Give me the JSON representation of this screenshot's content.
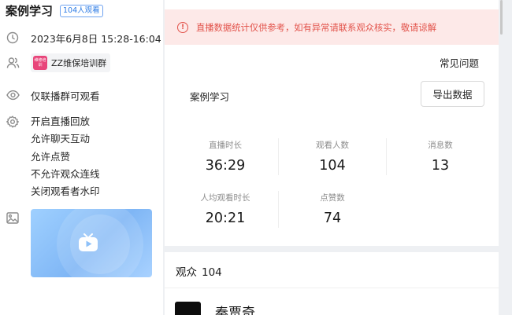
{
  "header": {
    "title": "案例学习",
    "views_badge": "104人观看"
  },
  "info": {
    "time": "2023年6月8日 15:28-16:04",
    "group": {
      "logo_text": "维修培训",
      "name": "ZZ维保培训群"
    },
    "watch_permission": "仅联播群可观看",
    "settings": [
      "开启直播回放",
      "允许聊天互动",
      "允许点赞",
      "不允许观众连线",
      "关闭观看者水印"
    ],
    "icons": [
      "clock-icon",
      "users-icon",
      "eye-icon",
      "gear-icon",
      "image-icon",
      "tv-icon"
    ]
  },
  "alert": {
    "message": "直播数据统计仅供参考，如有异常请联系观众核实，敬请谅解",
    "color": "#e2524a"
  },
  "panel": {
    "faq": "常见问题",
    "live_name": "案例学习",
    "export_button": "导出数据"
  },
  "stats": [
    {
      "label": "直播时长",
      "value": "36:29"
    },
    {
      "label": "观看人数",
      "value": "104"
    },
    {
      "label": "消息数",
      "value": "13"
    },
    {
      "label": "人均观看时长",
      "value": "20:21"
    },
    {
      "label": "点赞数",
      "value": "74"
    }
  ],
  "audience": {
    "label": "观众",
    "count": "104",
    "first_user": "秦贾奇"
  }
}
